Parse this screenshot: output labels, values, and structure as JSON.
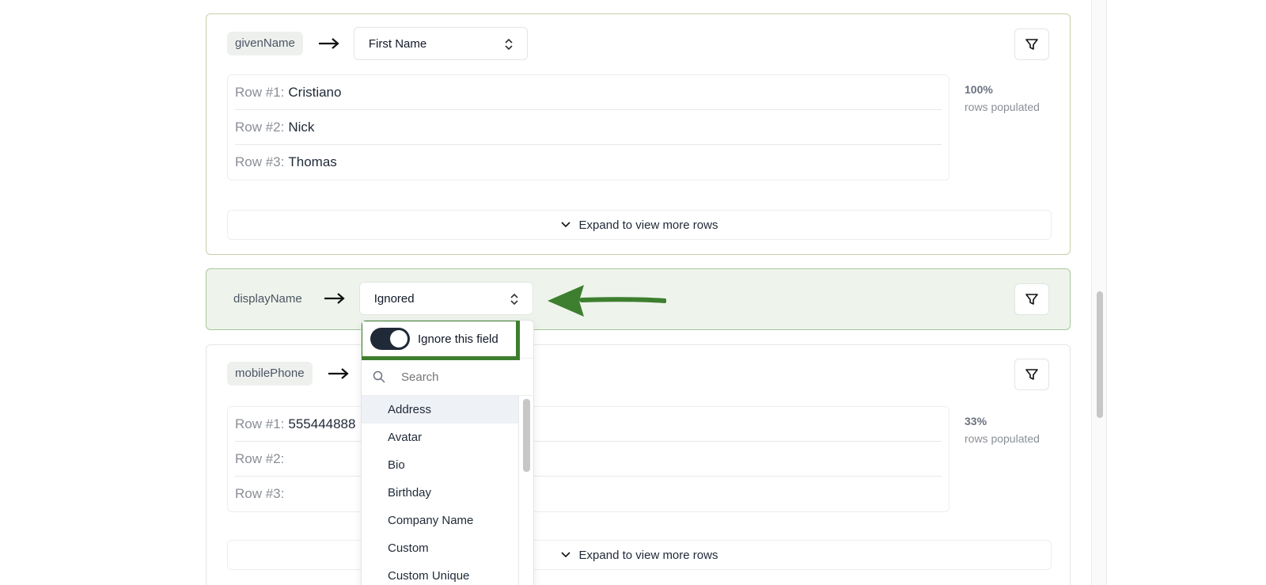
{
  "card1": {
    "field": "givenName",
    "mapping": "First Name",
    "rows": [
      {
        "label": "Row #1:",
        "value": "Cristiano"
      },
      {
        "label": "Row #2:",
        "value": "Nick"
      },
      {
        "label": "Row #3:",
        "value": "Thomas"
      }
    ],
    "stat_pct": "100%",
    "stat_text": "rows populated",
    "expand": "Expand to view more rows"
  },
  "card2": {
    "field": "displayName",
    "mapping": "Ignored"
  },
  "card3": {
    "field": "mobilePhone",
    "rows": [
      {
        "label": "Row #1:",
        "value": "555444888"
      },
      {
        "label": "Row #2:",
        "value": ""
      },
      {
        "label": "Row #3:",
        "value": ""
      }
    ],
    "stat_pct": "33%",
    "stat_text": "rows populated",
    "expand": "Expand to view more rows"
  },
  "dropdown": {
    "toggle_label": "Ignore this field",
    "toggle_on": true,
    "search_placeholder": "Search",
    "options": [
      "Address",
      "Avatar",
      "Bio",
      "Birthday",
      "Company Name",
      "Custom",
      "Custom Unique"
    ]
  },
  "colors": {
    "highlight_green": "#3d7f2f",
    "ignored_card_bg": "#eef4ec"
  },
  "icons": {
    "arrow": "arrow-right-icon",
    "filter": "filter-icon",
    "caret": "chevron-up-down-icon",
    "expand": "chevron-down-icon",
    "search": "search-icon"
  }
}
